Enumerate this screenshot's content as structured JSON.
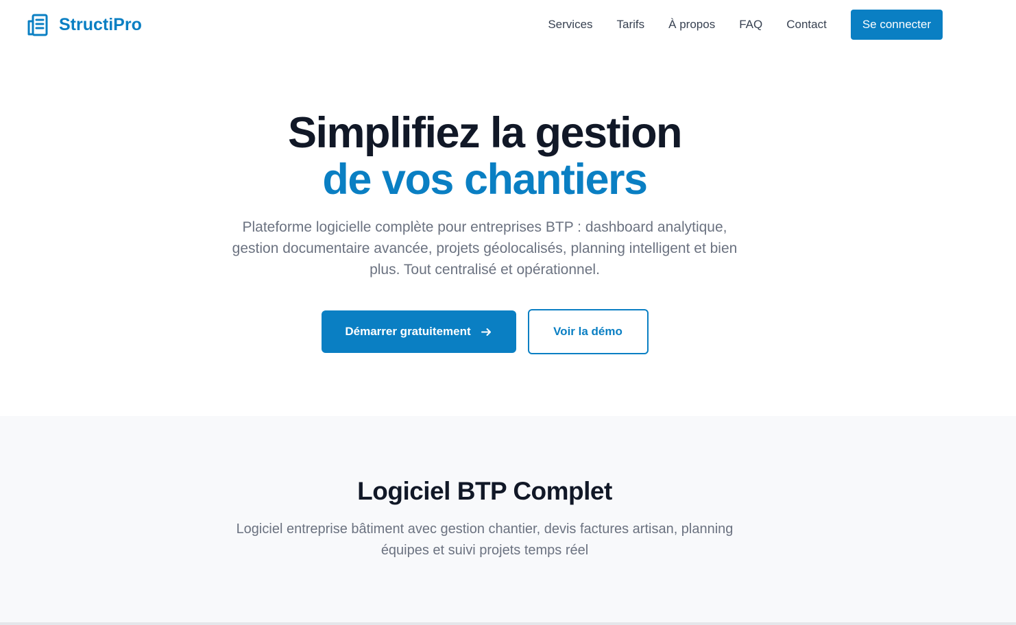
{
  "header": {
    "brand_name": "StructiPro",
    "brand_icon": "building-icon",
    "nav": [
      {
        "label": "Services"
      },
      {
        "label": "Tarifs"
      },
      {
        "label": "À propos"
      },
      {
        "label": "FAQ"
      },
      {
        "label": "Contact"
      }
    ],
    "login_label": "Se connecter"
  },
  "hero": {
    "title_line1": "Simplifiez la gestion",
    "title_line2": "de vos chantiers",
    "description": "Plateforme logicielle complète pour entreprises BTP : dashboard analytique, gestion documentaire avancée, projets géolocalisés, planning intelligent et bien plus. Tout centralisé et opérationnel.",
    "primary_cta": "Démarrer gratuitement",
    "primary_cta_icon": "arrow-right-icon",
    "secondary_cta": "Voir la démo"
  },
  "features": {
    "title": "Logiciel BTP Complet",
    "description": "Logiciel entreprise bâtiment avec gestion chantier, devis factures artisan, planning équipes et suivi projets temps réel"
  },
  "colors": {
    "brand": "#0a7fc3",
    "heading": "#111827",
    "muted": "#6b7280",
    "section_bg": "#f8f9fb"
  }
}
